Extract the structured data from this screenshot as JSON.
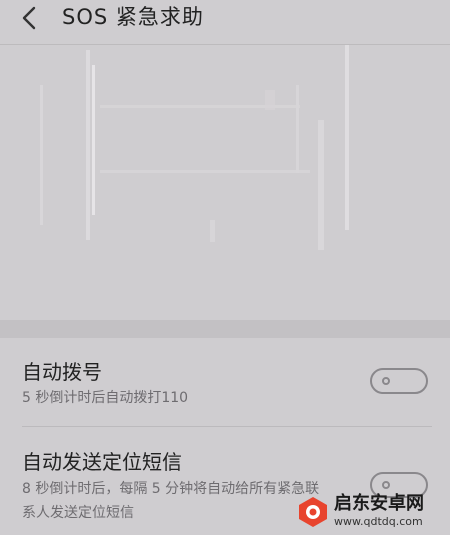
{
  "header": {
    "title": "SOS 紧急求助",
    "back_icon": "chevron-left-icon"
  },
  "settings": [
    {
      "title": "自动拨号",
      "description": "5 秒倒计时后自动拨打110",
      "enabled": false
    },
    {
      "title": "自动发送定位短信",
      "description_line1": "8 秒倒计时后，每隔 5 分钟将自动给所有紧急联",
      "description_line2": "系人发送定位短信",
      "enabled": false
    }
  ],
  "watermark": {
    "name": "启东安卓网",
    "url": "www.qdtdq.com",
    "logo_color": "#e8442e"
  },
  "colors": {
    "background": "#cfcdd0",
    "section_gap": "#c3c1c4"
  }
}
